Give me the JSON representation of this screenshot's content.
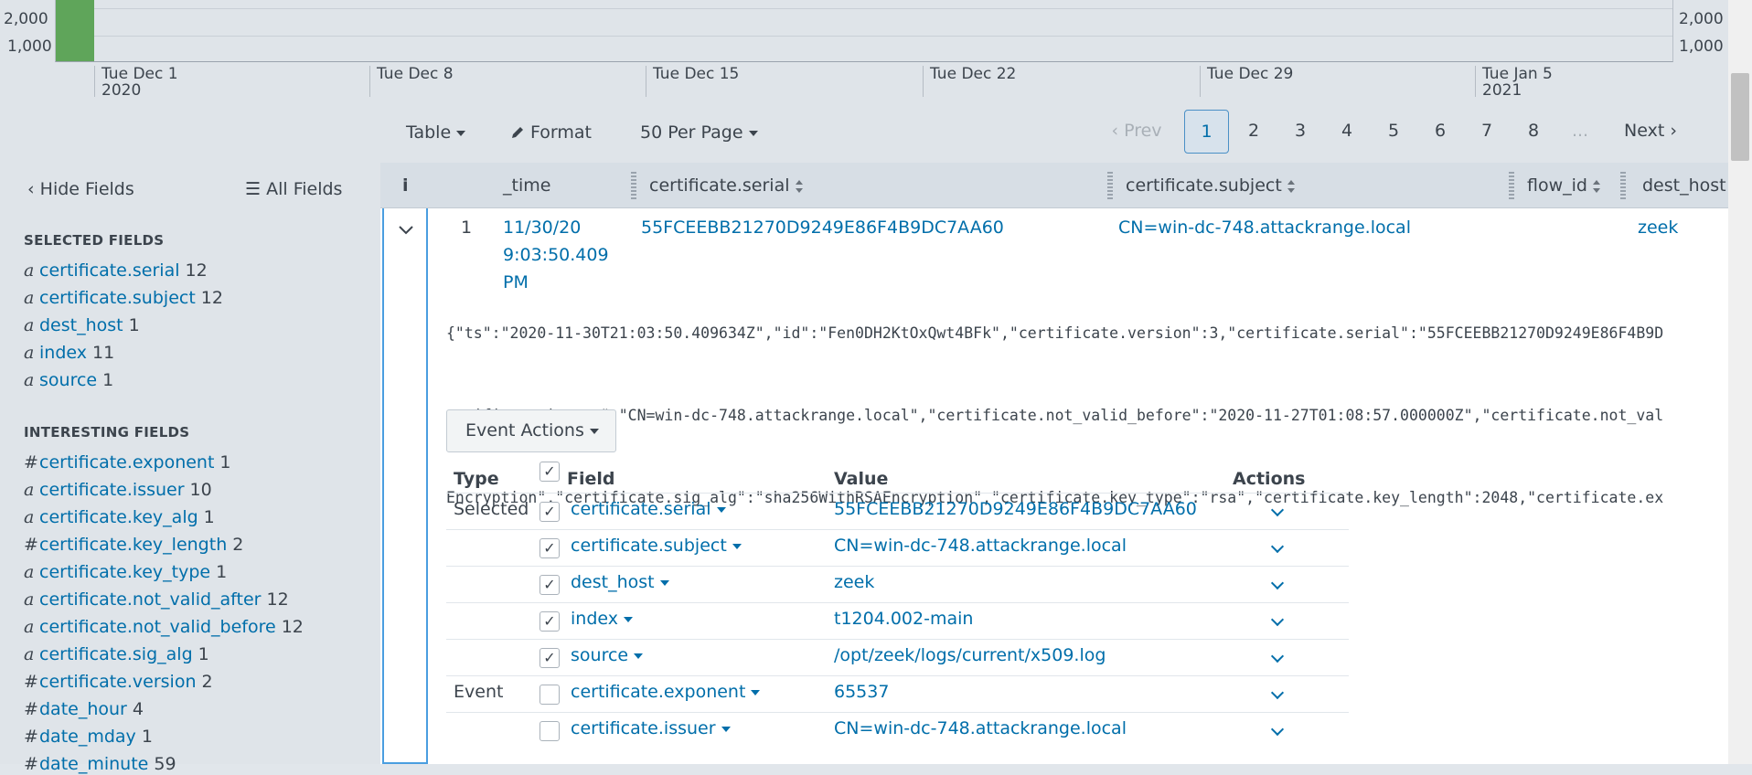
{
  "timeline": {
    "y_ticks": [
      "2,000",
      "1,000"
    ],
    "x_ticks": [
      {
        "line1": "Tue Dec 1",
        "line2": "2020"
      },
      {
        "line1": "Tue Dec 8",
        "line2": ""
      },
      {
        "line1": "Tue Dec 15",
        "line2": ""
      },
      {
        "line1": "Tue Dec 22",
        "line2": ""
      },
      {
        "line1": "Tue Dec 29",
        "line2": ""
      },
      {
        "line1": "Tue Jan 5",
        "line2": "2021"
      }
    ],
    "bar_color": "#5fa55a"
  },
  "toolbar": {
    "table_label": "Table",
    "format_label": "Format",
    "per_page_label": "50 Per Page",
    "prev_label": "Prev",
    "pages": [
      "1",
      "2",
      "3",
      "4",
      "5",
      "6",
      "7",
      "8"
    ],
    "ellipsis": "...",
    "next_label": "Next",
    "active_page": "1"
  },
  "sidebar": {
    "hide_fields": "Hide Fields",
    "all_fields": "All Fields",
    "selected_title": "SELECTED FIELDS",
    "selected": [
      {
        "type": "a",
        "name": "certificate.serial",
        "count": "12"
      },
      {
        "type": "a",
        "name": "certificate.subject",
        "count": "12"
      },
      {
        "type": "a",
        "name": "dest_host",
        "count": "1"
      },
      {
        "type": "a",
        "name": "index",
        "count": "11"
      },
      {
        "type": "a",
        "name": "source",
        "count": "1"
      }
    ],
    "interesting_title": "INTERESTING FIELDS",
    "interesting": [
      {
        "type": "#",
        "name": "certificate.exponent",
        "count": "1"
      },
      {
        "type": "a",
        "name": "certificate.issuer",
        "count": "10"
      },
      {
        "type": "a",
        "name": "certificate.key_alg",
        "count": "1"
      },
      {
        "type": "#",
        "name": "certificate.key_length",
        "count": "2"
      },
      {
        "type": "a",
        "name": "certificate.key_type",
        "count": "1"
      },
      {
        "type": "a",
        "name": "certificate.not_valid_after",
        "count": "12"
      },
      {
        "type": "a",
        "name": "certificate.not_valid_before",
        "count": "12"
      },
      {
        "type": "a",
        "name": "certificate.sig_alg",
        "count": "1"
      },
      {
        "type": "#",
        "name": "certificate.version",
        "count": "2"
      },
      {
        "type": "#",
        "name": "date_hour",
        "count": "4"
      },
      {
        "type": "#",
        "name": "date_mday",
        "count": "1"
      },
      {
        "type": "#",
        "name": "date_minute",
        "count": "59"
      }
    ]
  },
  "table": {
    "headers": {
      "info": "i",
      "time": "_time",
      "serial": "certificate.serial",
      "subject": "certificate.subject",
      "flow_id": "flow_id",
      "dest_host": "dest_host"
    },
    "row": {
      "index": "1",
      "time_line1": "11/30/20",
      "time_line2": "9:03:50.409",
      "time_line3": "PM",
      "serial": "55FCEEBB21270D9249E86F4B9DC7AA60",
      "subject": "CN=win-dc-748.attackrange.local",
      "dest_host": "zeek"
    },
    "raw_lines": [
      "{\"ts\":\"2020-11-30T21:03:50.409634Z\",\"id\":\"Fen0DH2KtOxQwt4BFk\",\"certificate.version\":3,\"certificate.serial\":\"55FCEEBB21270D9249E86F4B9D",
      "ertificate.issuer\":\"CN=win-dc-748.attackrange.local\",\"certificate.not_valid_before\":\"2020-11-27T01:08:57.000000Z\",\"certificate.not_val",
      "Encryption\",\"certificate.sig_alg\":\"sha256WithRSAEncryption\",\"certificate.key_type\":\"rsa\",\"certificate.key_length\":2048,\"certificate.ex"
    ],
    "event_actions": "Event Actions"
  },
  "field_table": {
    "headers": {
      "type": "Type",
      "field": "Field",
      "value": "Value",
      "actions": "Actions"
    },
    "rows": [
      {
        "type": "Selected",
        "checked": true,
        "field": "certificate.serial",
        "value": "55FCEEBB21270D9249E86F4B9DC7AA60"
      },
      {
        "type": "",
        "checked": true,
        "field": "certificate.subject",
        "value": "CN=win-dc-748.attackrange.local"
      },
      {
        "type": "",
        "checked": true,
        "field": "dest_host",
        "value": "zeek"
      },
      {
        "type": "",
        "checked": true,
        "field": "index",
        "value": "t1204.002-main"
      },
      {
        "type": "",
        "checked": true,
        "field": "source",
        "value": "/opt/zeek/logs/current/x509.log"
      },
      {
        "type": "Event",
        "checked": false,
        "field": "certificate.exponent",
        "value": "65537"
      },
      {
        "type": "",
        "checked": false,
        "field": "certificate.issuer",
        "value": "CN=win-dc-748.attackrange.local"
      }
    ]
  },
  "colors": {
    "link": "#006eaa",
    "accent_border": "#4a9ee0",
    "header_bg": "#d7dee5",
    "sidebar_bg": "#dfe4e9"
  }
}
